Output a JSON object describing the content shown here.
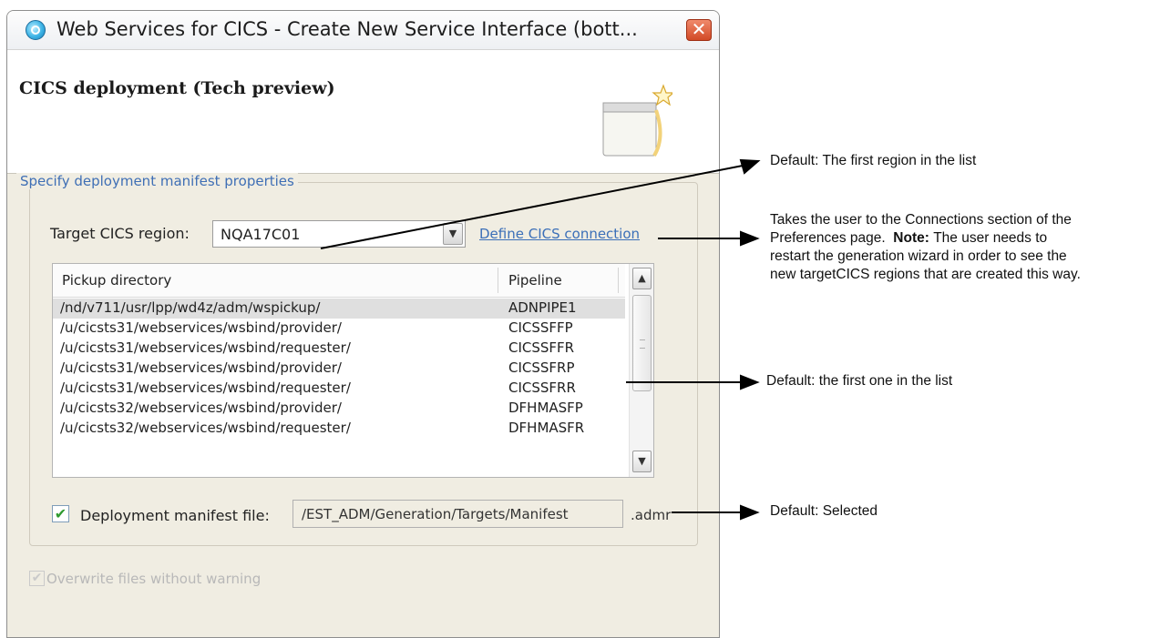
{
  "stray_mark": "̆",
  "dialog": {
    "title": "Web Services for CICS - Create New Service Interface (bott...",
    "close_symbol": "✕",
    "header_title": "CICS deployment (Tech preview)",
    "group_label": "Specify deployment manifest properties",
    "target_region_label": "Target CICS region:",
    "target_region_value": "NQA17C01",
    "define_link": "Define CICS connection",
    "table": {
      "columns": [
        "Pickup directory",
        "Pipeline"
      ],
      "rows": [
        {
          "dir": "/nd/v711/usr/lpp/wd4z/adm/wspickup/",
          "pipe": "ADNPIPE1"
        },
        {
          "dir": "/u/cicsts31/webservices/wsbind/provider/",
          "pipe": "CICSSFFP"
        },
        {
          "dir": "/u/cicsts31/webservices/wsbind/requester/",
          "pipe": "CICSSFFR"
        },
        {
          "dir": "/u/cicsts31/webservices/wsbind/provider/",
          "pipe": "CICSSFRP"
        },
        {
          "dir": "/u/cicsts31/webservices/wsbind/requester/",
          "pipe": "CICSSFRR"
        },
        {
          "dir": "/u/cicsts32/webservices/wsbind/provider/",
          "pipe": "DFHMASFP"
        },
        {
          "dir": "/u/cicsts32/webservices/wsbind/requester/",
          "pipe": "DFHMASFR"
        }
      ]
    },
    "manifest_label": "Deployment manifest file:",
    "manifest_value": "/EST_ADM/Generation/Targets/Manifest",
    "manifest_ext": ".admr",
    "manifest_checked": true,
    "overwrite_label": "Overwrite files without warning",
    "overwrite_checked": true
  },
  "annotations": {
    "region": "Default: The first region in the list",
    "connection_lines": [
      "Takes the user to the Connections section of the",
      "Preferences page.",
      "Note:",
      "The user needs to",
      "restart the generation wizard in order to see the",
      "new targetCICS regions that are created this way."
    ],
    "pickup": "Default: the first one in the list",
    "manifest": "Default: Selected"
  }
}
